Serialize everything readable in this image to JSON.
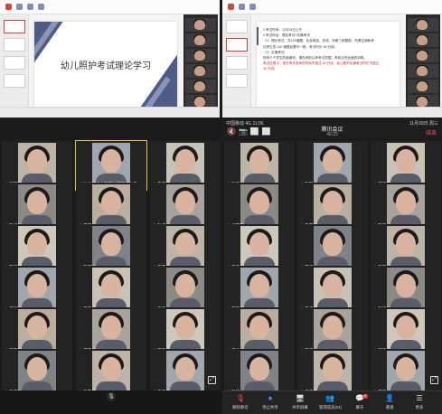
{
  "left_slide": {
    "title": "幼儿照护考试理论学习"
  },
  "right_slide": {
    "lines": [
      "1.考试时间：12月24日上午",
      "2.考试科目：理论考试+实操考试",
      "（1）理论考试，共100道题，包含单选、多选、判断三种题型，所需注释和考",
      "试考生的 100 道题目需不一致，考试时长 90 分钟。",
      "（2）实操考试",
      "所有个个学生的面操作，请在考前认考考试范围，考前见完全面的训练。",
      "考试过程中，现在有关老师的时间不超过 30 分钟，幼儿照护实操考试时长不超过",
      "30 分钟。"
    ]
  },
  "meeting": {
    "carrier_left": "中国移动 4G 11:06",
    "carrier_right": "11月30日 周三",
    "title": "腾讯会议",
    "elapsed": "46:25",
    "end_label": "结束",
    "toolbar": [
      {
        "label": "解除静音",
        "icon": "mic-off-icon"
      },
      {
        "label": "停止共享",
        "icon": "stop-share-icon"
      },
      {
        "label": "共享屏幕",
        "icon": "share-screen-icon"
      },
      {
        "label": "管理成员(51)",
        "icon": "members-icon"
      },
      {
        "label": "聊天",
        "icon": "chat-icon",
        "badge": "9"
      },
      {
        "label": "邀请",
        "icon": "invite-icon"
      },
      {
        "label": "更多",
        "icon": "more-icon"
      }
    ]
  },
  "left_grid": [
    [
      "张园园",
      "幼儿照护中等职业学院班主任",
      "曹雨欣"
    ],
    [
      "张灵彩",
      "黄雨",
      "孙妍"
    ],
    [
      "熊欣雅",
      "刘佳丽",
      "曾莹"
    ],
    [
      "黄丽丽",
      "王丽",
      "王紫"
    ],
    [
      "梁玉洁",
      "郭佳佳",
      "周雅"
    ],
    [
      "张紫晗",
      "张嘉欣",
      "王子妍"
    ]
  ],
  "right_grid": [
    [
      "张佳",
      "刘雨",
      "方晓雅"
    ],
    [
      "胡晨雪",
      "王嘉欣",
      "刘佳"
    ],
    [
      "王美",
      "李佳",
      "刘宁"
    ],
    [
      "宋宇宁",
      "尹佳佳",
      "赵欣然"
    ],
    [
      "杨林",
      "罗欣",
      "万佳"
    ],
    [
      "张欣",
      "马晓雯",
      "王佳"
    ]
  ]
}
